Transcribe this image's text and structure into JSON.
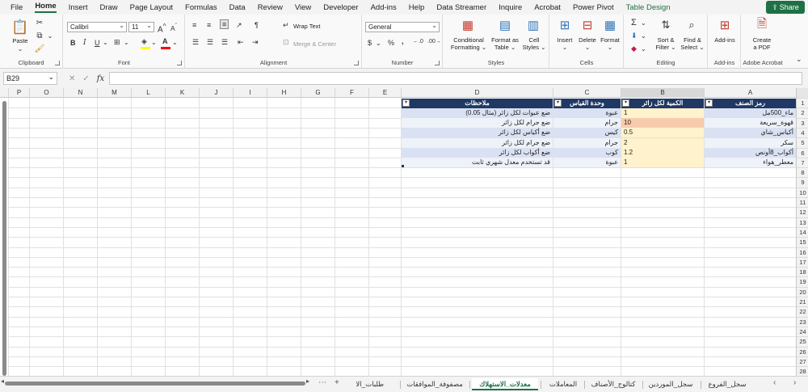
{
  "menu": {
    "tabs": [
      "File",
      "Home",
      "Insert",
      "Draw",
      "Page Layout",
      "Formulas",
      "Data",
      "Review",
      "View",
      "Developer",
      "Add-ins",
      "Help",
      "Data Streamer",
      "Inquire",
      "Acrobat",
      "Power Pivot",
      "Table Design"
    ],
    "active": "Home",
    "contextual": "Table Design",
    "share": "Share"
  },
  "ribbon": {
    "clipboard": {
      "label": "Clipboard",
      "paste": "Paste"
    },
    "font": {
      "label": "Font",
      "name": "Calibri",
      "size": "11",
      "bold": "B",
      "italic": "I",
      "underline": "U",
      "grow": "A",
      "shrink": "A"
    },
    "alignment": {
      "label": "Alignment",
      "wrap_text": "Wrap Text",
      "merge_center": "Merge & Center"
    },
    "number": {
      "label": "Number",
      "format": "General",
      "currency": "$",
      "percent": "%",
      "comma": ","
    },
    "styles": {
      "label": "Styles",
      "conditional": "Conditional",
      "conditional2": "Formatting",
      "format_table": "Format as",
      "format_table2": "Table",
      "cell_styles": "Cell",
      "cell_styles2": "Styles"
    },
    "cells": {
      "label": "Cells",
      "insert": "Insert",
      "delete": "Delete",
      "format": "Format"
    },
    "editing": {
      "label": "Editing",
      "sort": "Sort &",
      "sort2": "Filter",
      "find": "Find &",
      "find2": "Select",
      "sum": "Σ"
    },
    "addins": {
      "label": "Add-ins",
      "addins": "Add-ins"
    },
    "acrobat": {
      "label": "Adobe Acrobat",
      "create": "Create",
      "create2": "a PDF"
    }
  },
  "formula_bar": {
    "name_box": "B29",
    "fx": "fx",
    "cancel": "✕",
    "enter": "✓",
    "formula": ""
  },
  "grid": {
    "columns": [
      "P",
      "O",
      "N",
      "M",
      "L",
      "K",
      "J",
      "I",
      "H",
      "G",
      "F",
      "E",
      "D",
      "C",
      "B",
      "A"
    ],
    "selected_column": "B",
    "rows": [
      "1",
      "2",
      "3",
      "4",
      "5",
      "6",
      "7",
      "8",
      "9",
      "10",
      "11",
      "12",
      "13",
      "14",
      "15",
      "16",
      "17",
      "18",
      "19",
      "20",
      "21",
      "22",
      "23",
      "24",
      "25",
      "26",
      "27",
      "28"
    ],
    "table": {
      "headers": {
        "A": "رمز الصنف",
        "B": "الكمية لكل زائر",
        "C": "وحدة القياس",
        "D": "ملاحظات"
      },
      "rows": [
        {
          "A": "ماء_500مل",
          "B": "1",
          "C": "عبوة",
          "D": "ضع عبوات لكل زائر (مثال 0.05)"
        },
        {
          "A": "قهوة_سريعة",
          "B": "10",
          "C": "جرام",
          "D": "ضع جرام لكل زائر"
        },
        {
          "A": "أكياس_شاي",
          "B": "0.5",
          "C": "كيس",
          "D": "ضع أكياس لكل زائر"
        },
        {
          "A": "سكر",
          "B": "2",
          "C": "جرام",
          "D": "ضع جرام لكل زائر"
        },
        {
          "A": "أكواب_8أونص",
          "B": "1.2",
          "C": "كوب",
          "D": "ضع أكواب لكل زائر"
        },
        {
          "A": "معطر_هواء",
          "B": "1",
          "C": "عبوة",
          "D": "قد تستخدم معدل شهري ثابت"
        }
      ]
    }
  },
  "sheets": {
    "tabs": [
      "سجل_الفروع",
      "سجل_الموردين",
      "كتالوج_الأصناف",
      "المعاملات",
      "معدلات_الاستهلاك",
      "مصفوفة_الموافقات",
      "طلبات_الا"
    ],
    "active": "معدلات_الاستهلاك",
    "add": "+",
    "more": "⋯"
  }
}
